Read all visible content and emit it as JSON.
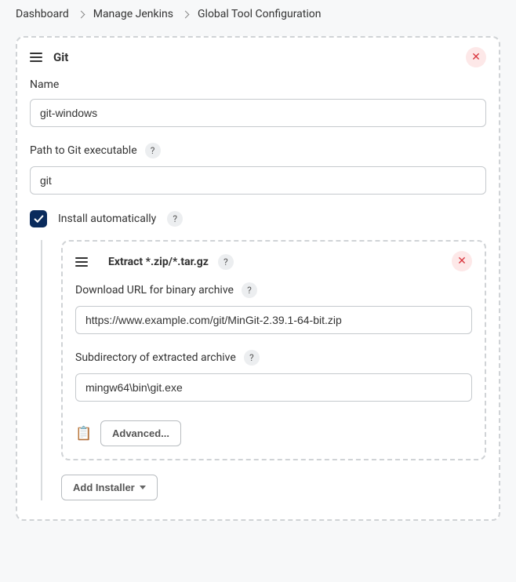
{
  "breadcrumb": {
    "items": [
      "Dashboard",
      "Manage Jenkins",
      "Global Tool Configuration"
    ]
  },
  "git_panel": {
    "title": "Git",
    "name_label": "Name",
    "name_value": "git-windows",
    "path_label": "Path to Git executable",
    "path_value": "git",
    "install_auto_label": "Install automatically",
    "install_auto_checked": true
  },
  "installer": {
    "title": "Extract *.zip/*.tar.gz",
    "download_label": "Download URL for binary archive",
    "download_value": "https://www.example.com/git/MinGit-2.39.1-64-bit.zip",
    "subdir_label": "Subdirectory of extracted archive",
    "subdir_value": "mingw64\\bin\\git.exe",
    "advanced_label": "Advanced...",
    "add_installer_label": "Add Installer"
  }
}
